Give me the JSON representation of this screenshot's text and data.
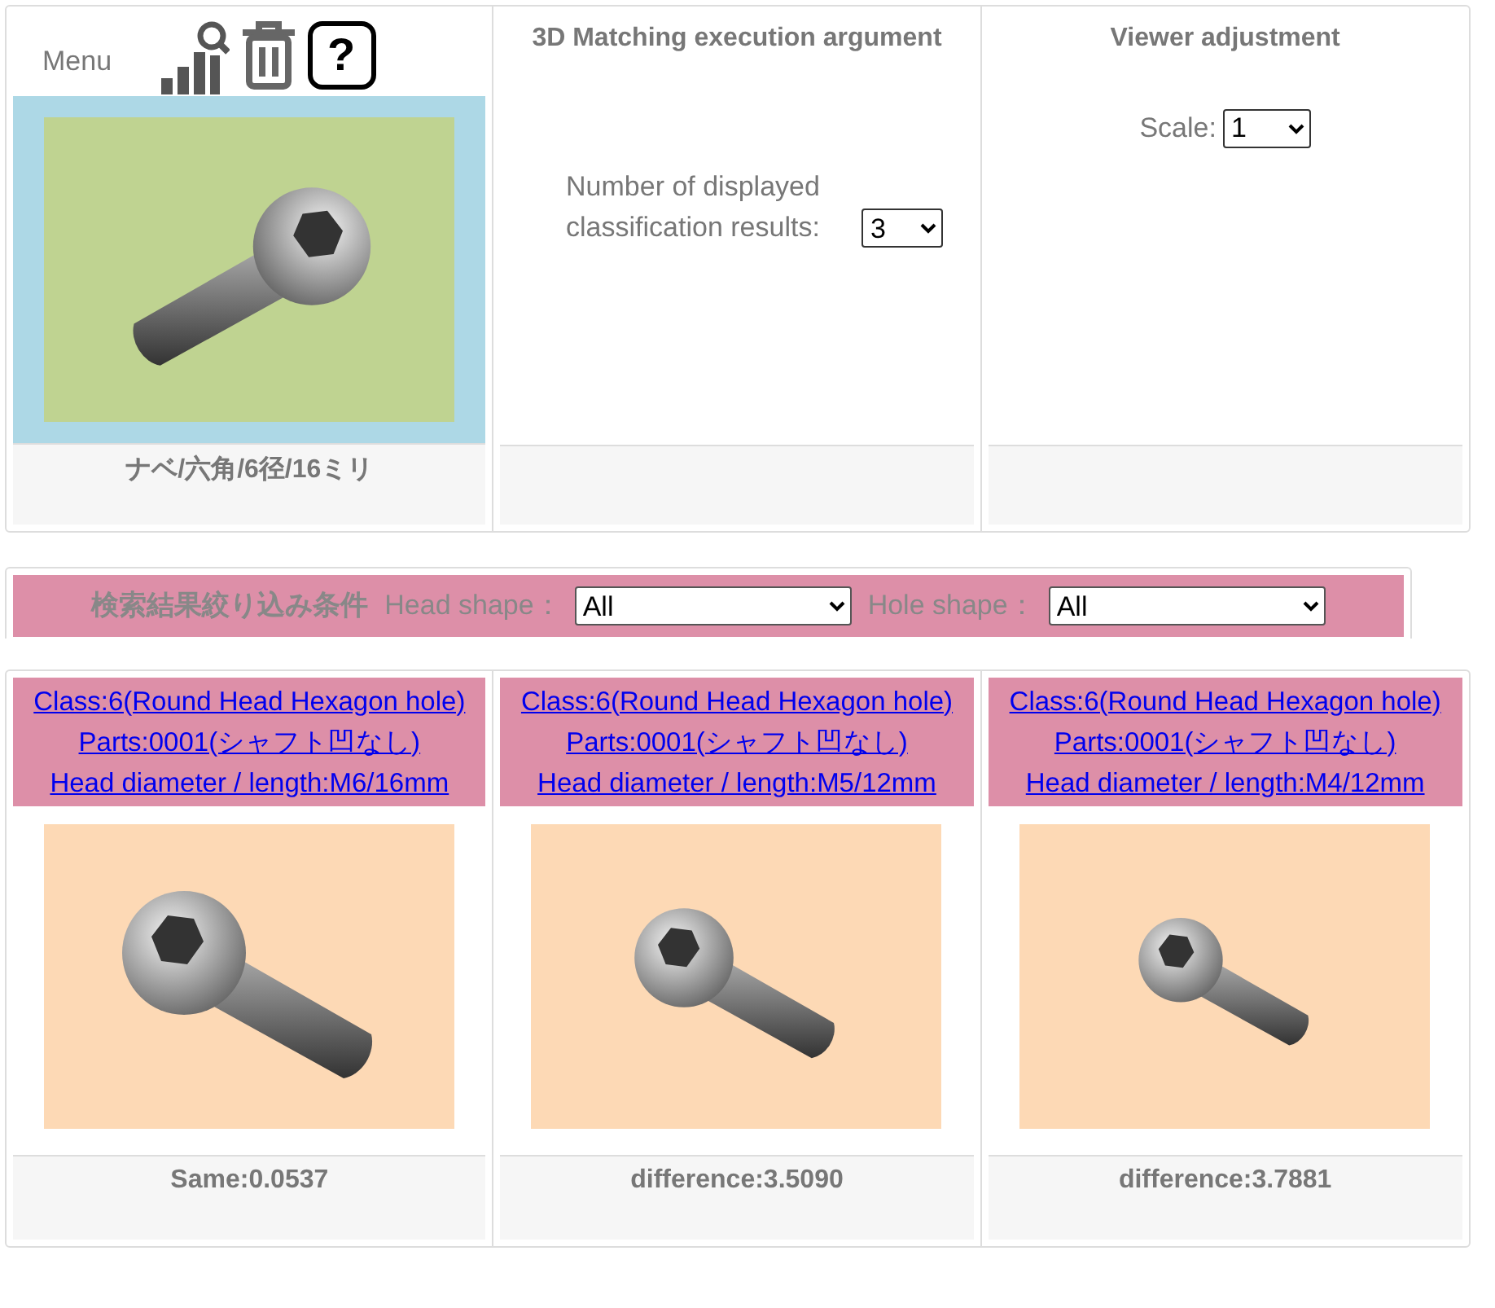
{
  "menu": {
    "label": "Menu",
    "help": "?"
  },
  "query": {
    "caption": "ナベ/六角/6径/16ミリ"
  },
  "matching": {
    "title": "3D Matching execution argument",
    "label": "Number of displayed classification results:",
    "value": "3"
  },
  "viewer": {
    "title": "Viewer adjustment",
    "label": "Scale:",
    "value": "1"
  },
  "filter": {
    "title": "検索結果絞り込み条件",
    "fields": [
      {
        "label": "Head shape：",
        "value": "All"
      },
      {
        "label": "Hole shape：",
        "value": "All"
      }
    ]
  },
  "results": [
    {
      "links": [
        "Class:6(Round Head Hexagon hole)",
        "Parts:0001(シャフト凹なし)",
        "Head diameter / length:M6/16mm"
      ],
      "score": "Same:0.0537"
    },
    {
      "links": [
        "Class:6(Round Head Hexagon hole)",
        "Parts:0001(シャフト凹なし)",
        "Head diameter / length:M5/12mm"
      ],
      "score": "difference:3.5090"
    },
    {
      "links": [
        "Class:6(Round Head Hexagon hole)",
        "Parts:0001(シャフト凹なし)",
        "Head diameter / length:M4/12mm"
      ],
      "score": "difference:3.7881"
    }
  ]
}
